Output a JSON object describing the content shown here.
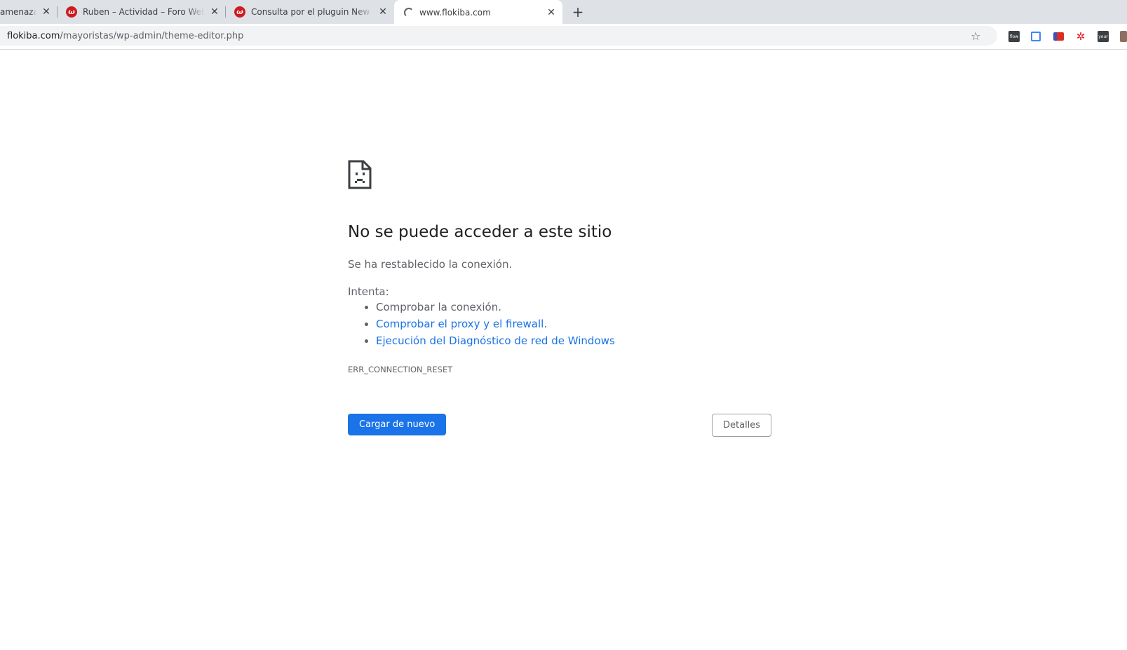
{
  "browser": {
    "tabs": [
      {
        "title": "amenazas",
        "favicon": "none"
      },
      {
        "title": "Ruben – Actividad – Foro Webempresa",
        "favicon": "webempresa-icon"
      },
      {
        "title": "Consulta por el pluguin New User",
        "favicon": "webempresa-icon"
      },
      {
        "title": "www.flokiba.com",
        "favicon": "loading-spinner",
        "active": true
      }
    ],
    "close_glyph": "✕",
    "new_tab_glyph": "+",
    "address_bar": {
      "host": "flokiba.com",
      "path": "/mayoristas/wp-admin/theme-editor.php"
    },
    "star_glyph": "☆",
    "extensions": [
      {
        "name": "flow-extension-icon",
        "label": "flow",
        "color": "#3c4043"
      },
      {
        "name": "blue-extension-icon",
        "label": "",
        "color": "#4285f4"
      },
      {
        "name": "flag-extension-icon",
        "label": "",
        "color": "#d93025"
      },
      {
        "name": "bug-extension-icon",
        "label": "",
        "color": "#ea1d24"
      },
      {
        "name": "dark-extension-icon",
        "label": "your",
        "color": "#3c4043"
      },
      {
        "name": "partial-extension-icon",
        "label": "",
        "color": "#8d6e63"
      }
    ]
  },
  "error_page": {
    "title": "No se puede acceder a este sitio",
    "description": "Se ha restablecido la conexión.",
    "try_label": "Intenta:",
    "suggestions": [
      {
        "text": "Comprobar la conexión.",
        "link": false
      },
      {
        "text": "Comprobar el proxy y el firewall",
        "link": true,
        "suffix": "."
      },
      {
        "text": "Ejecución del Diagnóstico de red de Windows",
        "link": true,
        "suffix": ""
      }
    ],
    "error_code": "ERR_CONNECTION_RESET",
    "reload_button": "Cargar de nuevo",
    "details_button": "Detalles",
    "colors": {
      "primary_button": "#1a73e8",
      "link": "#1a73e8",
      "text_secondary": "#5f6368"
    }
  }
}
